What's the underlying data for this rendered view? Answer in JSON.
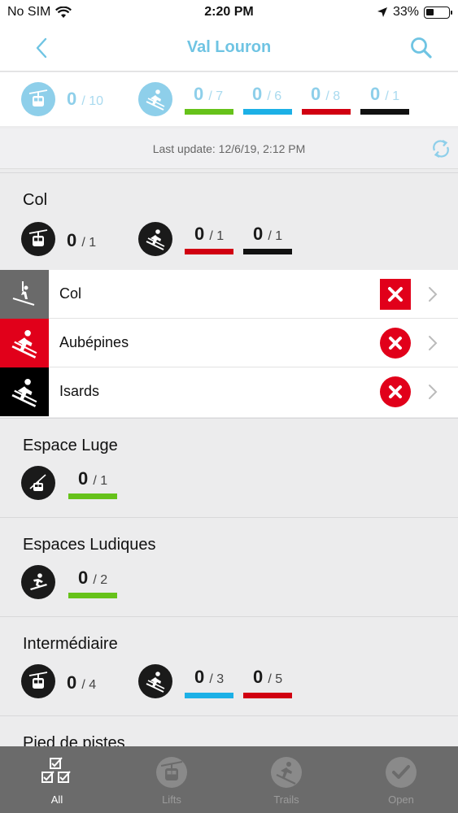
{
  "status_bar": {
    "carrier": "No SIM",
    "time": "2:20 PM",
    "battery": "33%",
    "battery_level": 0.33
  },
  "header": {
    "title": "Val Louron"
  },
  "summary": {
    "lifts": {
      "open": "0",
      "total": "/ 10"
    },
    "trails": [
      {
        "open": "0",
        "total": "/ 7",
        "color": "#66c21a"
      },
      {
        "open": "0",
        "total": "/ 6",
        "color": "#1cb0e6"
      },
      {
        "open": "0",
        "total": "/ 8",
        "color": "#d10011"
      },
      {
        "open": "0",
        "total": "/ 1",
        "color": "#111111"
      }
    ]
  },
  "last_update": "Last update: 12/6/19, 2:12 PM",
  "sections": {
    "col": {
      "title": "Col",
      "lifts": {
        "open": "0",
        "total": "/ 1"
      },
      "trails": [
        {
          "open": "0",
          "total": "/ 1",
          "color": "#d10011"
        },
        {
          "open": "0",
          "total": "/ 1",
          "color": "#111111"
        }
      ],
      "items": [
        {
          "name": "Col",
          "icon": "ski-lift-icon",
          "color": "#6a6a6a"
        },
        {
          "name": "Aubépines",
          "icon": "skier-icon",
          "color": "#e1001a"
        },
        {
          "name": "Isards",
          "icon": "skier-icon",
          "color": "#000000"
        }
      ]
    },
    "espace_luge": {
      "title": "Espace Luge",
      "lifts": {
        "open": "0",
        "total": "/ 1",
        "color": "#66c21a"
      }
    },
    "espaces_ludiques": {
      "title": "Espaces Ludiques",
      "park": {
        "open": "0",
        "total": "/ 2",
        "color": "#66c21a"
      }
    },
    "intermediaire": {
      "title": "Intermédiaire",
      "lifts": {
        "open": "0",
        "total": "/ 4"
      },
      "trails": [
        {
          "open": "0",
          "total": "/ 3",
          "color": "#1cb0e6"
        },
        {
          "open": "0",
          "total": "/ 5",
          "color": "#d10011"
        }
      ]
    },
    "pied_de_pistes": {
      "title": "Pied de pistes"
    }
  },
  "tabs": [
    {
      "label": "All",
      "icon": "checklist-icon",
      "active": true
    },
    {
      "label": "Lifts",
      "icon": "gondola-icon",
      "active": false
    },
    {
      "label": "Trails",
      "icon": "skier-icon",
      "active": false
    },
    {
      "label": "Open",
      "icon": "checkmark-icon",
      "active": false
    }
  ]
}
